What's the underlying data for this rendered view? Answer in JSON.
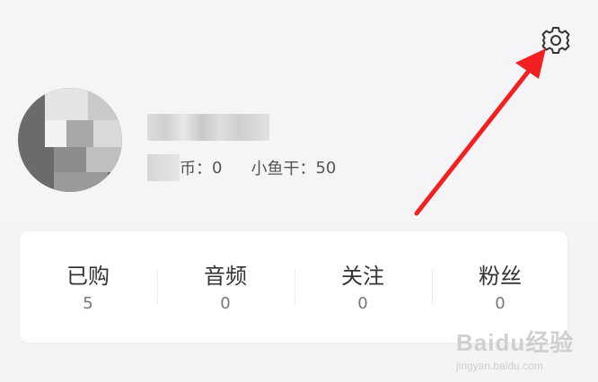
{
  "profile": {
    "currency": {
      "partial_label_end": "币：",
      "balance": "0",
      "fish_label": "小鱼干：",
      "fish_value": "50"
    }
  },
  "stats": [
    {
      "label": "已购",
      "value": "5"
    },
    {
      "label": "音频",
      "value": "0"
    },
    {
      "label": "关注",
      "value": "0"
    },
    {
      "label": "粉丝",
      "value": "0"
    }
  ],
  "icons": {
    "settings": "gear-icon"
  },
  "colors": {
    "annotation_arrow": "#f22020",
    "page_background": "#f4f3f5",
    "card_background": "#ffffff"
  },
  "watermark": {
    "main": "Baidu经验",
    "sub": "jingyan.baidu.com"
  }
}
